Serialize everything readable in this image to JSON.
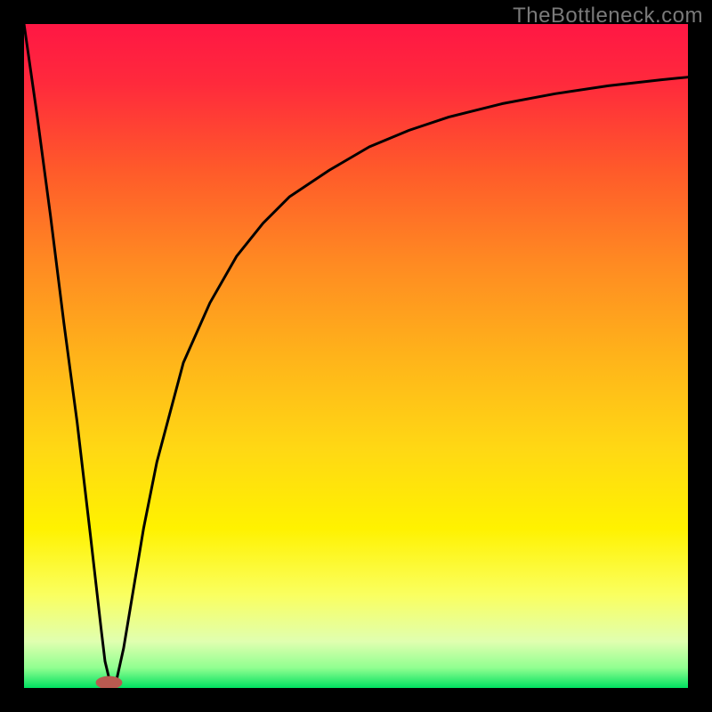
{
  "watermark": {
    "text": "TheBottleneck.com"
  },
  "chart_data": {
    "type": "line",
    "title": "",
    "xlabel": "",
    "ylabel": "",
    "xlim": [
      0,
      100
    ],
    "ylim": [
      0,
      100
    ],
    "grid": false,
    "legend": false,
    "background_gradient_stops": [
      {
        "pct": 0,
        "color": "#ff1744"
      },
      {
        "pct": 9,
        "color": "#ff2a3c"
      },
      {
        "pct": 22,
        "color": "#ff5a2a"
      },
      {
        "pct": 36,
        "color": "#ff8a22"
      },
      {
        "pct": 50,
        "color": "#ffb31a"
      },
      {
        "pct": 64,
        "color": "#ffd814"
      },
      {
        "pct": 76,
        "color": "#fff200"
      },
      {
        "pct": 86,
        "color": "#faff60"
      },
      {
        "pct": 93,
        "color": "#e0ffb0"
      },
      {
        "pct": 97,
        "color": "#90ff90"
      },
      {
        "pct": 100,
        "color": "#00e060"
      }
    ],
    "series": [
      {
        "name": "curve",
        "x": [
          0,
          2,
          4,
          6,
          8,
          10,
          11.6,
          12.2,
          12.8,
          13.4,
          14,
          15,
          16,
          18,
          20,
          24,
          28,
          32,
          36,
          40,
          46,
          52,
          58,
          64,
          72,
          80,
          88,
          96,
          100
        ],
        "y": [
          100,
          86,
          71,
          55,
          40,
          23,
          9,
          4,
          1.5,
          0.8,
          1.5,
          6,
          12,
          24,
          34,
          49,
          58,
          65,
          70,
          74,
          78,
          81.5,
          84,
          86,
          88,
          89.5,
          90.7,
          91.6,
          92
        ]
      }
    ],
    "marker": {
      "x": 12.8,
      "y": 0.8,
      "rx": 2.0,
      "ry": 1.0,
      "color": "#b85a50"
    }
  }
}
